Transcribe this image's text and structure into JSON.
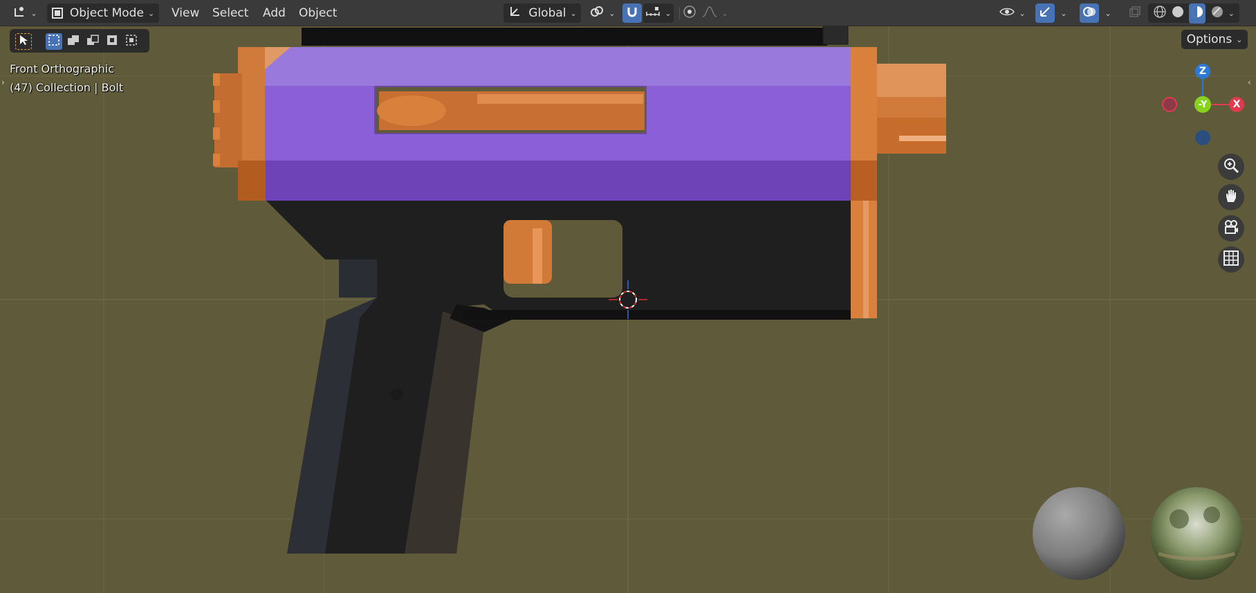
{
  "header": {
    "editor_type_icon": "3d-viewport-icon",
    "mode": {
      "label": "Object Mode",
      "icon": "object-mode-icon"
    },
    "menus": [
      {
        "id": "view",
        "label": "View"
      },
      {
        "id": "select",
        "label": "Select"
      },
      {
        "id": "add",
        "label": "Add"
      },
      {
        "id": "object",
        "label": "Object"
      }
    ],
    "transform_orientation": {
      "label": "Global",
      "icon": "orientation-axes-icon"
    },
    "pivot_icon": "pivot-link-icon",
    "snap_icon": "magnet-icon",
    "snap_target_icon": "snap-increment-icon",
    "proportional_icon": "proportional-editing-icon",
    "falloff_icon": "falloff-curve-icon",
    "visibility_icon": "eye-icon",
    "gizmo_icon": "gizmo-icon",
    "overlay_icon": "overlay-icon",
    "xray_icon": "xray-icon",
    "shading_modes": [
      "wireframe-icon",
      "solid-icon",
      "material-preview-icon",
      "rendered-icon"
    ]
  },
  "tool_row": {
    "select_tool_icon": "select-box-cursor-icon",
    "select_modes": [
      "select-new-icon",
      "select-extend-icon",
      "select-subtract-icon",
      "select-invert-icon",
      "select-intersect-icon"
    ]
  },
  "options": {
    "label": "Options"
  },
  "viewport": {
    "view_name": "Front Orthographic",
    "collection_info": "(47) Collection | Bolt"
  },
  "gizmo": {
    "z_label": "Z",
    "y_label": "-Y",
    "x_label": "X",
    "colors": {
      "x": "#e03a4f",
      "y": "#87d21c",
      "z": "#2d7ad6"
    }
  },
  "nav_buttons": [
    "zoom-icon",
    "hand-pan-icon",
    "camera-icon",
    "grid-ortho-icon"
  ],
  "colors": {
    "header_bg": "#3a3a3a",
    "viewport_bg": "#5e5a3a",
    "accent_blue": "#4772b3",
    "selected_purple": "#7c4fc9",
    "active_orange": "#d9813c",
    "body_dark": "#1f1f1f"
  }
}
